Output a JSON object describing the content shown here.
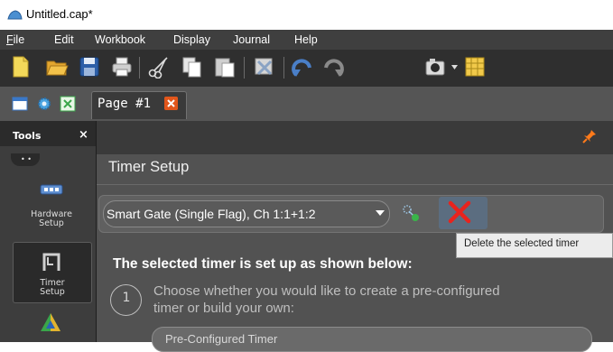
{
  "window": {
    "title": "Untitled.cap*"
  },
  "menu": [
    {
      "label": "File",
      "underline": "F"
    },
    {
      "label": "Edit"
    },
    {
      "label": "Workbook"
    },
    {
      "label": "Display"
    },
    {
      "label": "Journal"
    },
    {
      "label": "Help"
    }
  ],
  "toolbar_icons": [
    "new-file-icon",
    "open-folder-icon",
    "save-icon",
    "print-icon",
    "cut-icon",
    "copy-icon",
    "paste-icon",
    "delete-icon",
    "undo-icon",
    "redo-icon",
    "camera-icon",
    "table-icon"
  ],
  "page_tab": {
    "label": "Page #1"
  },
  "tools": {
    "title": "Tools",
    "close": "×",
    "items": [
      {
        "label_line1": "Hardware",
        "label_line2": "Setup"
      },
      {
        "label_line1": "Timer",
        "label_line2": "Setup"
      }
    ]
  },
  "panel": {
    "title": "Timer Setup"
  },
  "selector": {
    "value": "Smart Gate (Single Flag), Ch 1:1+1:2"
  },
  "tooltip": {
    "text": "Delete the selected timer"
  },
  "content": {
    "heading": "The selected timer is set up as shown below:",
    "step_number": "1",
    "step_line1": "Choose whether you would like to create a pre-configured",
    "step_line2": "timer or build your own:",
    "preconfig_button": "Pre-Configured Timer"
  },
  "colors": {
    "accent": "#e2561b",
    "delete": "#e8231d",
    "menubar": "#3f3f3f"
  }
}
